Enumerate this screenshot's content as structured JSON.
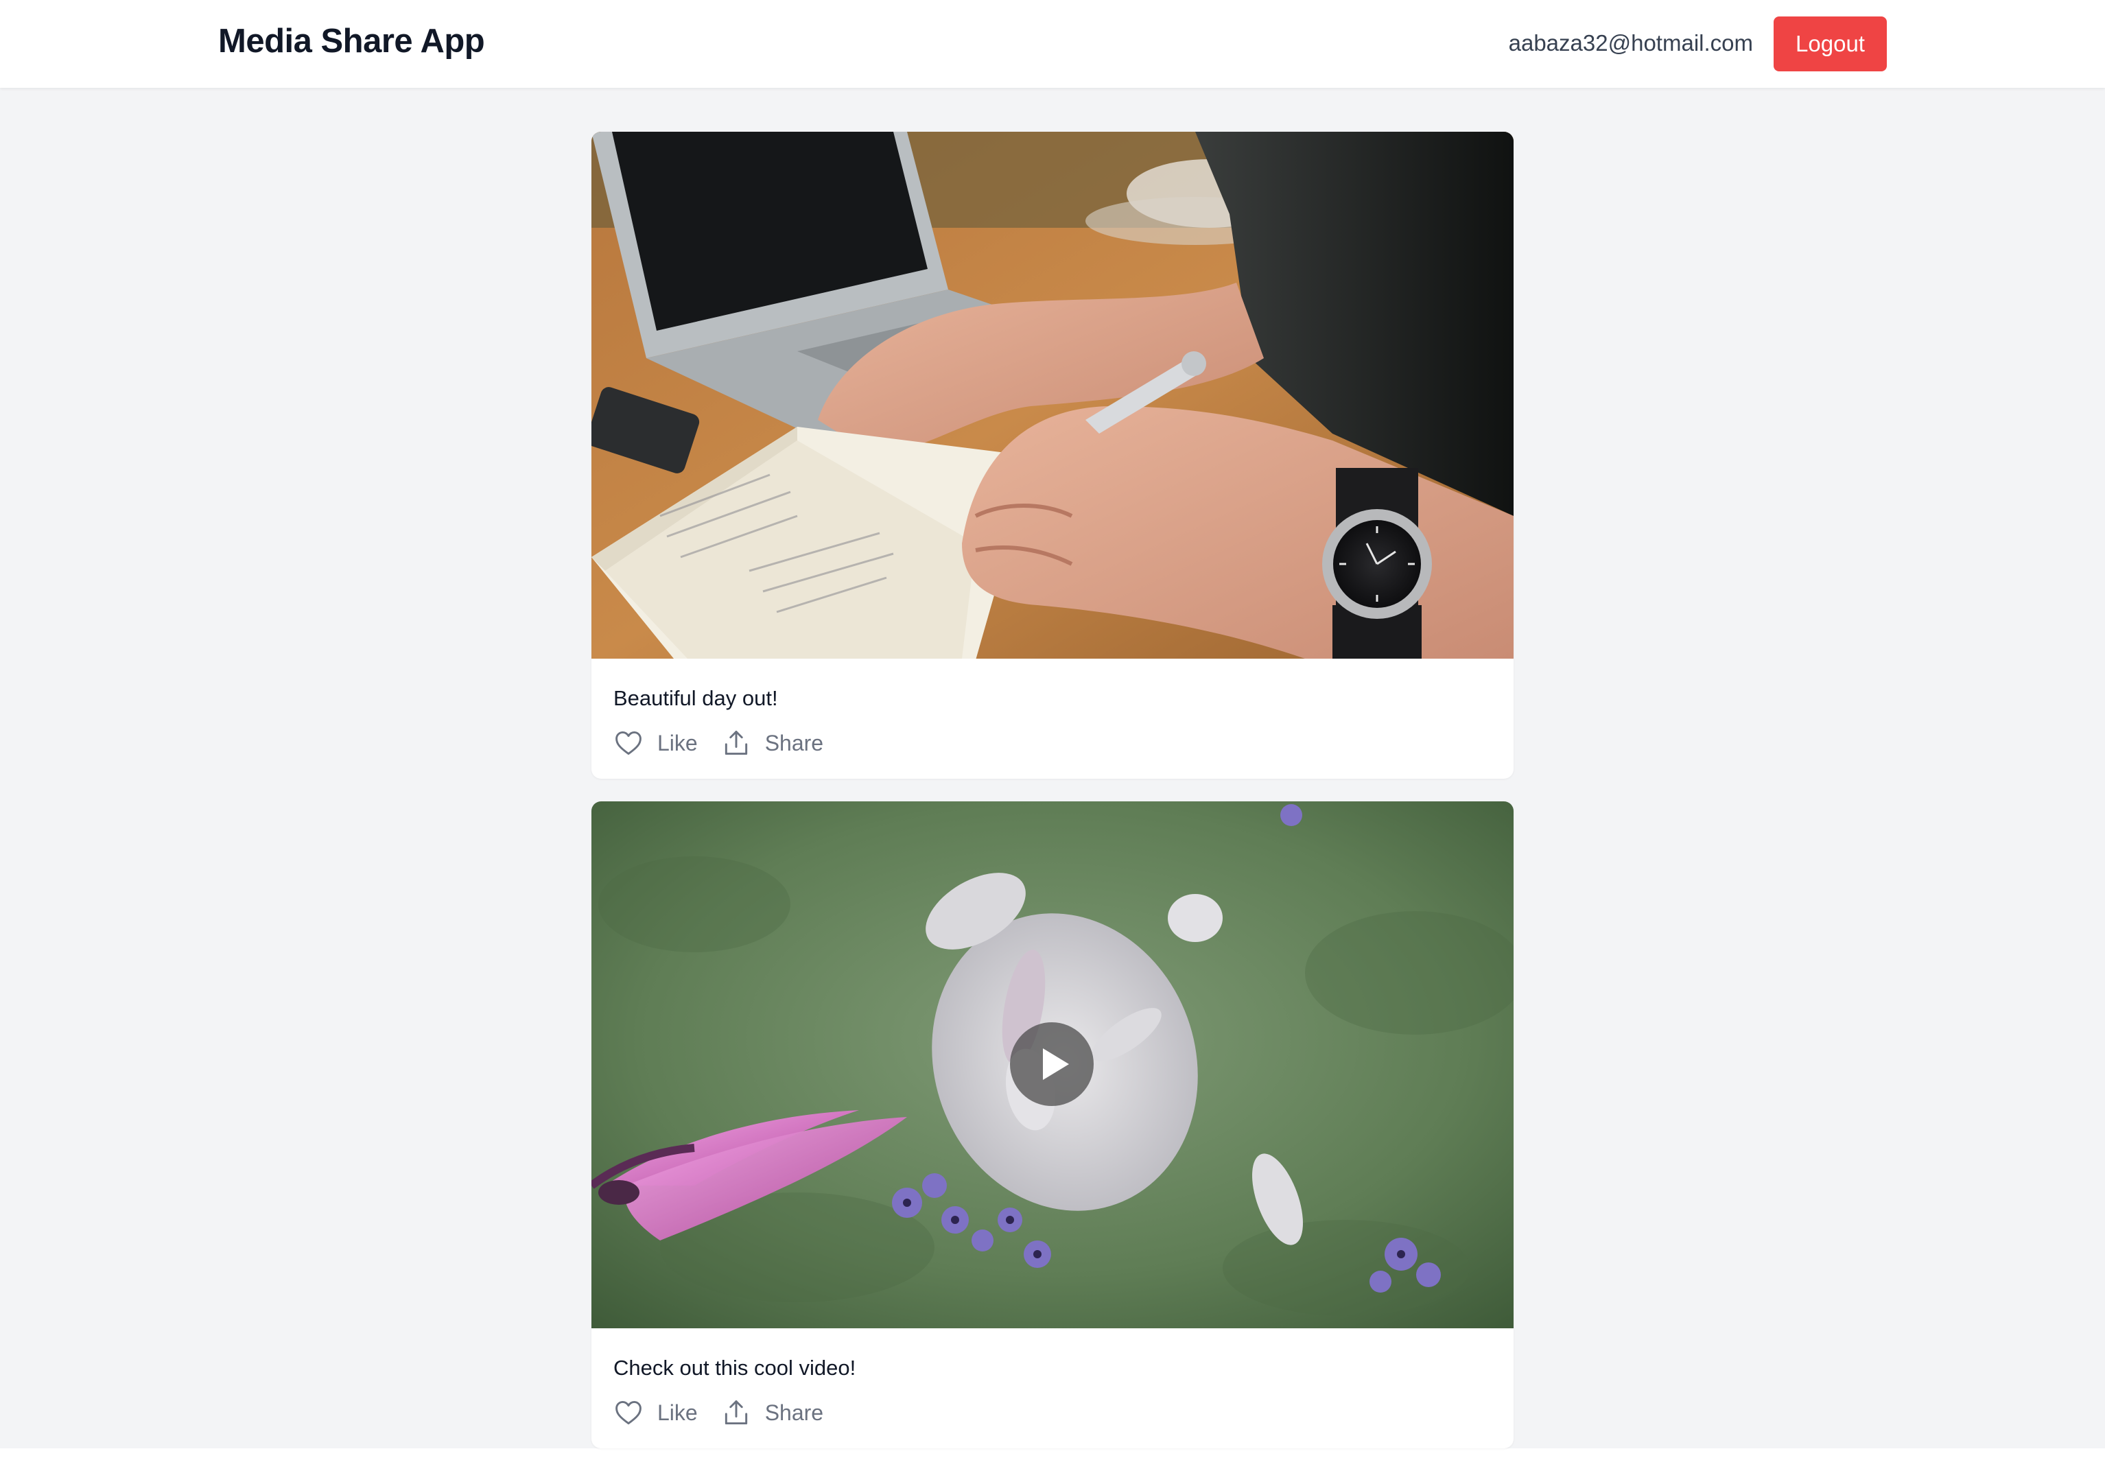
{
  "header": {
    "app_title": "Media Share App",
    "user_email": "aabaza32@hotmail.com",
    "logout_label": "Logout"
  },
  "colors": {
    "logout_button": "#ef4444",
    "page_background": "#f3f4f6",
    "title_text": "#111827",
    "action_text": "#6b7280"
  },
  "posts": [
    {
      "media_type": "image",
      "caption": "Beautiful day out!",
      "like_label": "Like",
      "share_label": "Share"
    },
    {
      "media_type": "video",
      "caption": "Check out this cool video!",
      "like_label": "Like",
      "share_label": "Share"
    }
  ],
  "icons": {
    "like": "heart-icon",
    "share": "share-upload-icon",
    "play": "play-icon"
  }
}
